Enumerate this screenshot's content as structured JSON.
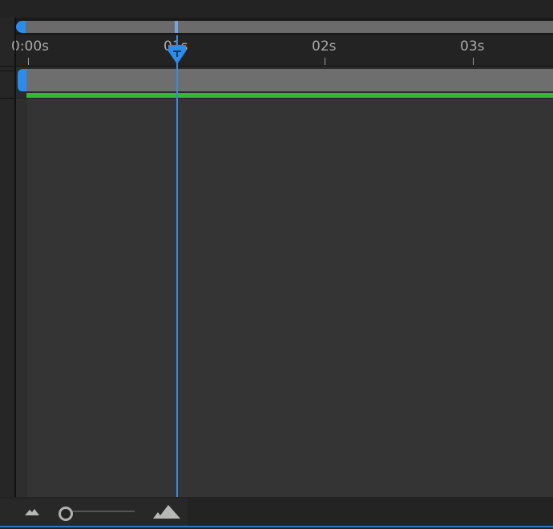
{
  "timeline": {
    "ruler": {
      "ticks": [
        "0:00s",
        "01s",
        "02s",
        "03s"
      ]
    },
    "icons": {
      "zoom_out": "mountain-small-icon",
      "zoom_in": "mountain-large-icon"
    },
    "colors": {
      "accent": "#2d8ceb",
      "work_area": "#2fba2f",
      "layer_bar": "#6e6e6e",
      "track_bg": "#343434"
    }
  }
}
